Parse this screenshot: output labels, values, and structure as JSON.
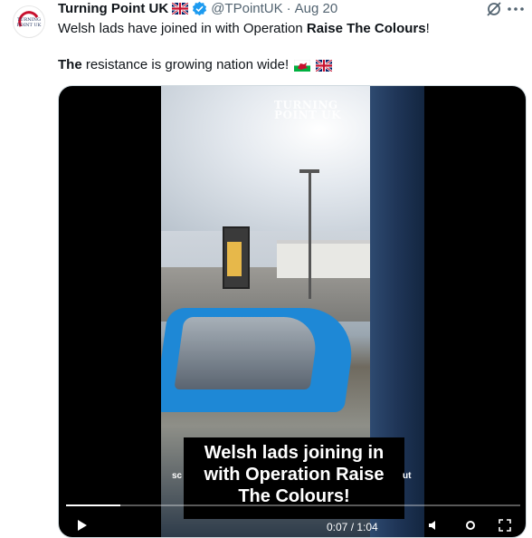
{
  "author": {
    "name": "Turning Point UK",
    "handle": "@TPointUK",
    "date": "Aug 20",
    "separator": "·",
    "avatar_text": "TURNING POINT UK",
    "verified": true
  },
  "icons": {
    "verified": "verified-badge-icon",
    "grok": "grok-icon",
    "more": "more-icon",
    "flag_uk": "uk-flag-icon",
    "flag_wales": "wales-flag-icon",
    "play": "play-icon",
    "mute": "volume-icon",
    "settings": "settings-icon",
    "fullscreen": "fullscreen-icon"
  },
  "colors": {
    "text": "#0f1419",
    "secondary": "#536471",
    "verified_blue": "#1d9bf0"
  },
  "tweet": {
    "line1_prefix": "Welsh lads have joined in with Operation ",
    "line1_bold": "Raise The Colours",
    "line1_suffix": "!",
    "line2_bold": "The",
    "line2_rest": " resistance is growing nation wide!"
  },
  "video": {
    "watermark_line1": "TURNING",
    "watermark_line2": "POINT UK",
    "caption_line1": "Welsh lads joining in",
    "caption_line2": "with Operation Raise",
    "caption_line3": "The Colours!",
    "side_left": "sc",
    "side_right": "ut",
    "progress": 0.12,
    "time": "0:07 / 1:04"
  }
}
